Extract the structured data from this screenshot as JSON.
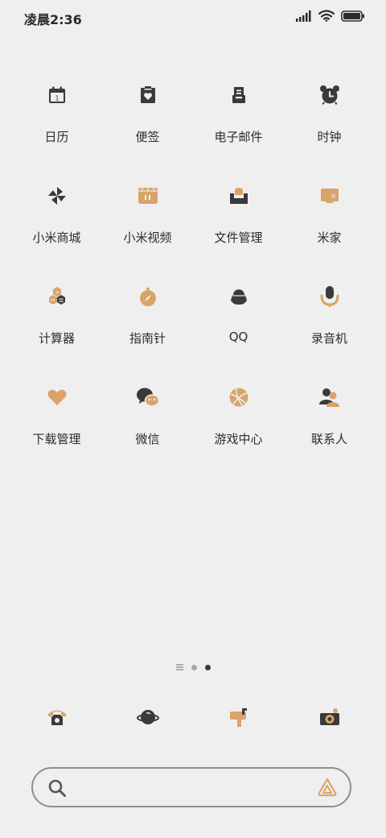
{
  "status_bar": {
    "time": "凌晨2:36",
    "icons": [
      "signal-icon",
      "wifi-icon",
      "battery-icon"
    ]
  },
  "colors": {
    "background": "#efefef",
    "icon_dark": "#3a3a3a",
    "icon_accent": "#d8a46a",
    "text": "#2d2d2d"
  },
  "apps": [
    {
      "label": "日历",
      "icon": "calendar-icon"
    },
    {
      "label": "便签",
      "icon": "notes-icon"
    },
    {
      "label": "电子邮件",
      "icon": "mail-icon"
    },
    {
      "label": "时钟",
      "icon": "alarm-clock-icon"
    },
    {
      "label": "小米商城",
      "icon": "pinwheel-icon"
    },
    {
      "label": "小米视频",
      "icon": "video-icon"
    },
    {
      "label": "文件管理",
      "icon": "file-manager-icon"
    },
    {
      "label": "米家",
      "icon": "tv-icon"
    },
    {
      "label": "计算器",
      "icon": "calculator-icon"
    },
    {
      "label": "指南针",
      "icon": "compass-icon"
    },
    {
      "label": "QQ",
      "icon": "penguin-icon"
    },
    {
      "label": "录音机",
      "icon": "microphone-icon"
    },
    {
      "label": "下载管理",
      "icon": "heart-icon"
    },
    {
      "label": "微信",
      "icon": "wechat-icon"
    },
    {
      "label": "游戏中心",
      "icon": "ball-icon"
    },
    {
      "label": "联系人",
      "icon": "contacts-icon"
    }
  ],
  "page_indicator": {
    "pages": 3,
    "current_page": 3
  },
  "dock": [
    {
      "icon": "phone-icon"
    },
    {
      "icon": "planet-icon"
    },
    {
      "icon": "mailbox-icon"
    },
    {
      "icon": "camera-icon"
    }
  ],
  "search": {
    "placeholder": "",
    "value": "",
    "icon": "search-icon",
    "assistant_icon": "assistant-icon"
  },
  "calendar_icon_day": "1"
}
